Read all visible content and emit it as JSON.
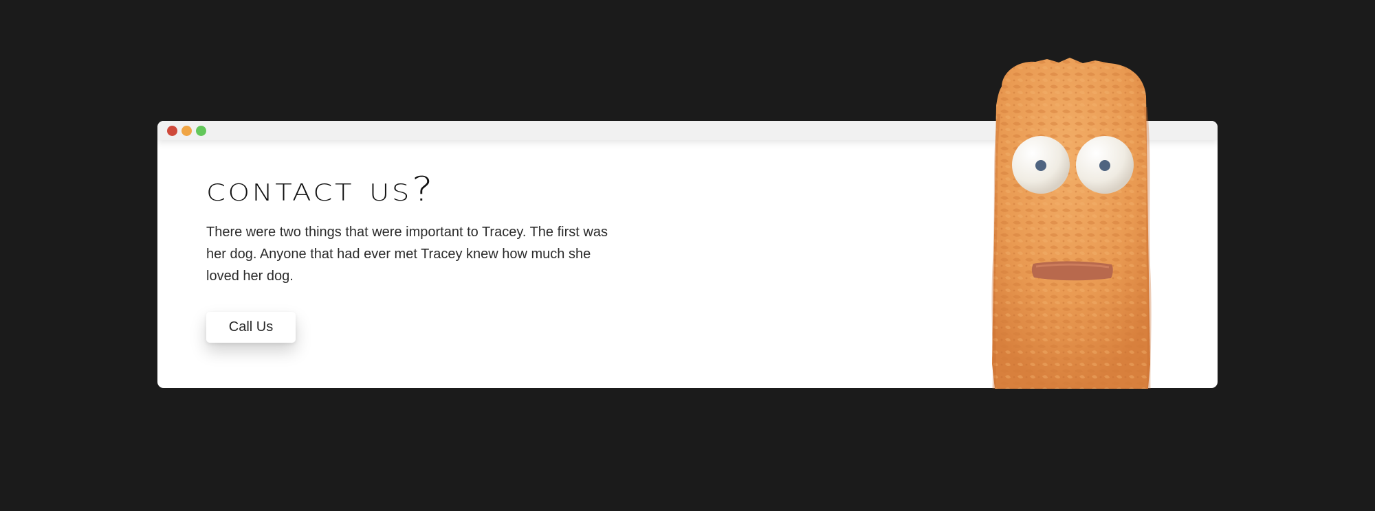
{
  "window": {
    "controls": [
      {
        "name": "close",
        "color": "#cf4a3b"
      },
      {
        "name": "minimize",
        "color": "#f0a545"
      },
      {
        "name": "zoom",
        "color": "#63c75a"
      }
    ]
  },
  "contact": {
    "heading": "Contact Us?",
    "paragraph": "There were two things that were important to Tracey. The first was her dog. Anyone that had ever met Tracey knew how much she loved her dog.",
    "button_label": "Call Us"
  },
  "mascot": {
    "icon": "orange-textured-character-icon",
    "colors": {
      "body": "#e99a52",
      "eye_white": "#f3efe6",
      "pupil": "#4f6480",
      "mouth": "#b8694d"
    }
  },
  "colors": {
    "page_background": "#1b1b1b",
    "window_background": "#ffffff",
    "titlebar_background": "#f1f1f1"
  }
}
